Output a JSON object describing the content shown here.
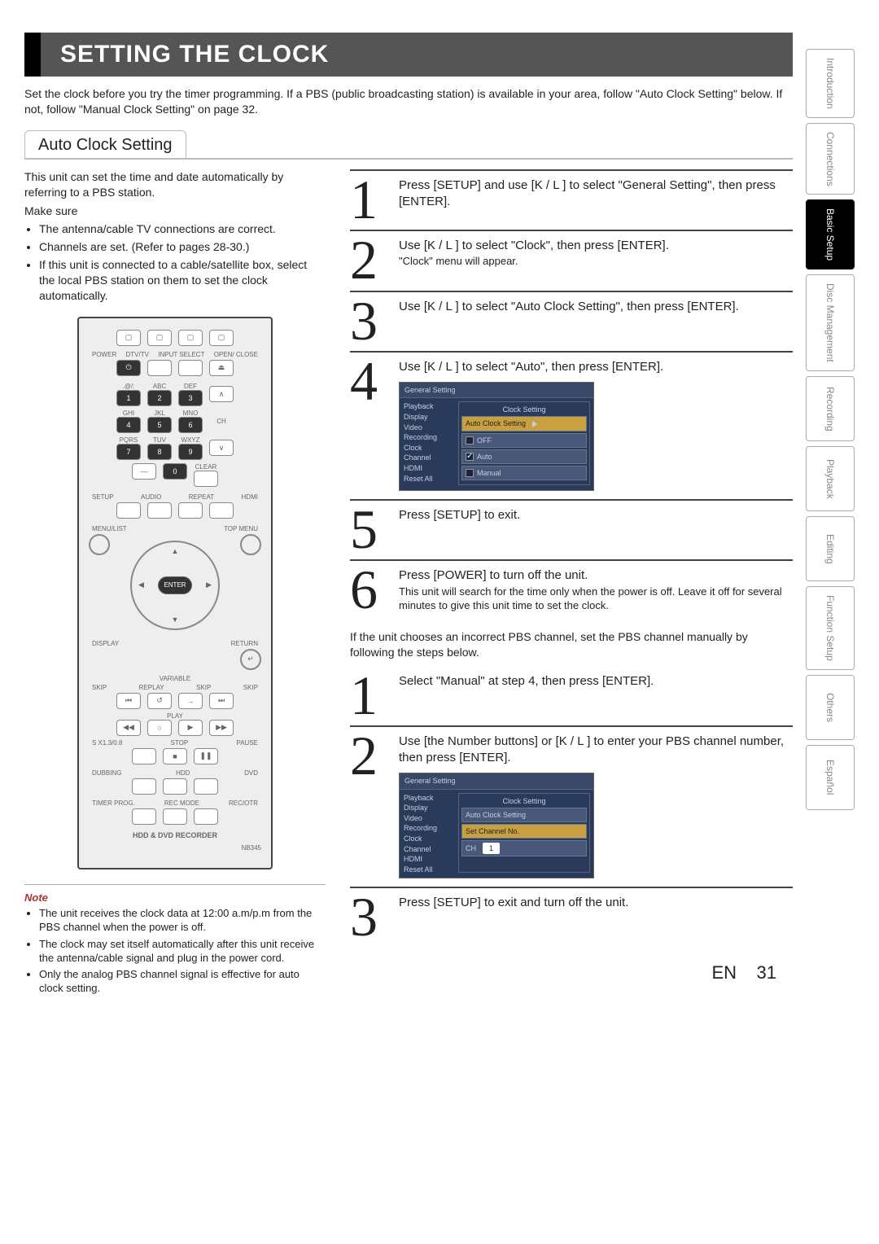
{
  "title": "SETTING THE CLOCK",
  "intro": "Set the clock before you try the timer programming. If a PBS (public broadcasting station) is available in your area, follow \"Auto Clock Setting\" below. If not, follow \"Manual Clock Setting\" on page 32.",
  "section_heading": "Auto Clock Setting",
  "left": {
    "lead": "This unit can set the time and date automatically by referring to a PBS station.",
    "make_sure": "Make sure",
    "bullets": [
      "The antenna/cable TV connections are correct.",
      "Channels are set. (Refer to pages 28-30.)",
      "If this unit is connected to a cable/satellite box, select the local PBS station on them to set the clock automatically."
    ]
  },
  "remote": {
    "row1": [
      "POWER",
      "DTV/TV",
      "INPUT SELECT",
      "OPEN/ CLOSE"
    ],
    "keypad": [
      {
        "sup": ".@/:",
        "num": "1"
      },
      {
        "sup": "ABC",
        "num": "2"
      },
      {
        "sup": "DEF",
        "num": "3"
      },
      {
        "sup": "GHI",
        "num": "4"
      },
      {
        "sup": "JKL",
        "num": "5"
      },
      {
        "sup": "MNO",
        "num": "6"
      },
      {
        "sup": "PQRS",
        "num": "7"
      },
      {
        "sup": "TUV",
        "num": "8"
      },
      {
        "sup": "WXYZ",
        "num": "9"
      },
      {
        "sup": "",
        "num": "—"
      },
      {
        "sup": "",
        "num": "0"
      },
      {
        "sup": "CLEAR",
        "num": ""
      }
    ],
    "ch": "CH",
    "row3": [
      "SETUP",
      "AUDIO",
      "REPEAT",
      "HDMI"
    ],
    "menu": "MENU/LIST",
    "topmenu": "TOP MENU",
    "enter": "ENTER",
    "display": "DISPLAY",
    "return": "RETURN",
    "variable": "VARIABLE",
    "skip": "SKIP",
    "replay": "REPLAY",
    "play": "PLAY",
    "stop": "STOP",
    "pause": "PAUSE",
    "speed": "S X1.3/0.8",
    "dubbing": "DUBBING",
    "hdd": "HDD",
    "dvd": "DVD",
    "timer": "TIMER PROG.",
    "recmode": "REC MODE",
    "recotr": "REC/OTR",
    "bottom": "HDD & DVD RECORDER",
    "model": "NB345"
  },
  "note": {
    "head": "Note",
    "items": [
      "The unit receives the clock data at 12:00 a.m/p.m from the PBS channel when the power is off.",
      "The clock may set itself automatically after this unit receive the antenna/cable signal and plug in the power cord.",
      "Only the analog PBS channel signal is effective for auto clock setting."
    ]
  },
  "steps_a": [
    {
      "num": "1",
      "text": "Press [SETUP] and use [K / L ] to select \"General Setting\", then press [ENTER]."
    },
    {
      "num": "2",
      "text": "Use [K / L ] to select \"Clock\", then press [ENTER].",
      "sub": "\"Clock\" menu will appear."
    },
    {
      "num": "3",
      "text": "Use [K / L ] to select \"Auto Clock Setting\", then press [ENTER]."
    },
    {
      "num": "4",
      "text": "Use [K / L ] to select \"Auto\", then press [ENTER].",
      "osd": "auto"
    },
    {
      "num": "5",
      "text": "Press [SETUP] to exit."
    },
    {
      "num": "6",
      "text": "Press [POWER] to turn off the unit.",
      "sub": "This unit will search for the time only when the power is off. Leave it off for several minutes to give this unit time to set the clock."
    }
  ],
  "between": "If the unit chooses an incorrect PBS channel, set the PBS channel manually by following the steps below.",
  "steps_b": [
    {
      "num": "1",
      "text": "Select \"Manual\" at step 4, then press [ENTER]."
    },
    {
      "num": "2",
      "text": "Use [the Number buttons] or [K / L ] to enter your PBS channel number, then press [ENTER].",
      "osd": "manual"
    },
    {
      "num": "3",
      "text": "Press [SETUP] to exit and turn off the unit."
    }
  ],
  "osd": {
    "head": "General Setting",
    "side": [
      "Playback",
      "Display",
      "Video",
      "Recording",
      "Clock",
      "Channel",
      "HDMI",
      "Reset All"
    ],
    "clock_setting": "Clock Setting",
    "auto_clock": "Auto Clock Setting",
    "off": "OFF",
    "auto": "Auto",
    "manual": "Manual",
    "set_ch": "Set Channel No.",
    "ch": "CH",
    "ch_val": "1"
  },
  "tabs": [
    "Introduction",
    "Connections",
    "Basic Setup",
    "Disc Management",
    "Recording",
    "Playback",
    "Editing",
    "Function Setup",
    "Others",
    "Español"
  ],
  "active_tab": 2,
  "footer_lang": "EN",
  "footer_page": "31"
}
